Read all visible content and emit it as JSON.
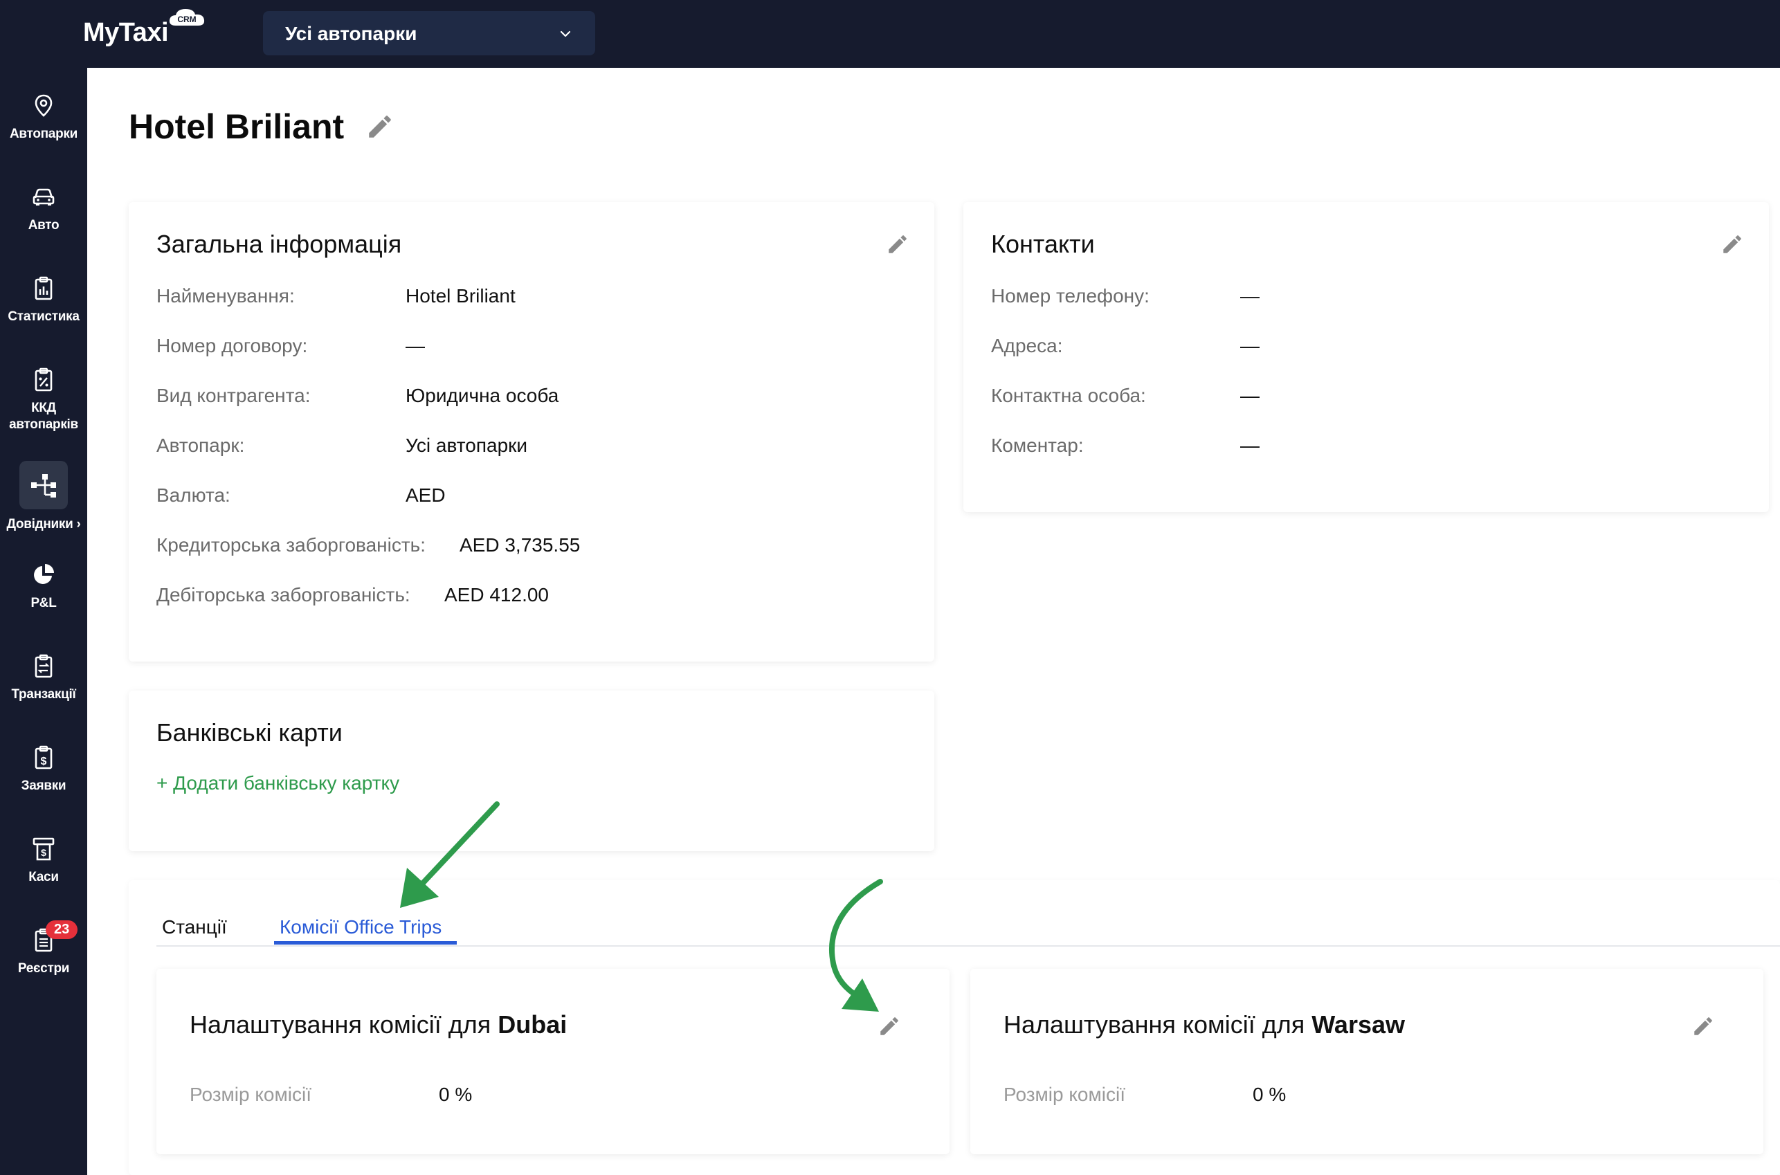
{
  "app": {
    "logo": "MyTaxi",
    "logo_badge": "CRM",
    "fleet_selector": {
      "value": "Усі автопарки"
    }
  },
  "sidebar": {
    "items": [
      {
        "label": "Автопарки",
        "icon": "location-pin-icon"
      },
      {
        "label": "Авто",
        "icon": "car-icon"
      },
      {
        "label": "Статистика",
        "icon": "stats-clipboard-icon"
      },
      {
        "label": "ККД автопарків",
        "icon": "percent-clipboard-icon"
      },
      {
        "label": "Довідники",
        "icon": "tree-structure-icon",
        "active": true
      },
      {
        "label": "P&L",
        "icon": "pie-chart-icon"
      },
      {
        "label": "Транзакції",
        "icon": "transactions-clipboard-icon"
      },
      {
        "label": "Заявки",
        "icon": "dollar-clipboard-icon"
      },
      {
        "label": "Каси",
        "icon": "cash-register-icon"
      },
      {
        "label": "Реєстри",
        "icon": "list-clipboard-icon",
        "badge": "23"
      }
    ]
  },
  "page": {
    "title": "Hotel Briliant"
  },
  "general_info": {
    "title": "Загальна інформація",
    "rows": [
      {
        "label": "Найменування:",
        "value": "Hotel Briliant"
      },
      {
        "label": "Номер договору:",
        "value": "—"
      },
      {
        "label": "Вид контрагента:",
        "value": "Юридична особа"
      },
      {
        "label": "Автопарк:",
        "value": "Усі автопарки"
      },
      {
        "label": "Валюта:",
        "value": "AED"
      },
      {
        "label": "Кредиторська заборгованість:",
        "value": "AED 3,735.55"
      },
      {
        "label": "Дебіторська заборгованість:",
        "value": "AED 412.00"
      }
    ]
  },
  "contacts": {
    "title": "Контакти",
    "rows": [
      {
        "label": "Номер телефону:",
        "value": "—"
      },
      {
        "label": "Адреса:",
        "value": "—"
      },
      {
        "label": "Контактна особа:",
        "value": "—"
      },
      {
        "label": "Коментар:",
        "value": "—"
      }
    ]
  },
  "bank_cards": {
    "title": "Банківські карти",
    "add_link": "+ Додати банківську картку"
  },
  "tabs": [
    {
      "label": "Станції",
      "active": false
    },
    {
      "label": "Комісії Office Trips",
      "active": true
    }
  ],
  "commissions": [
    {
      "title_prefix": "Налаштування комісії для",
      "city": "Dubai",
      "label": "Розмір комісії",
      "value": "0 %"
    },
    {
      "title_prefix": "Налаштування комісії для",
      "city": "Warsaw",
      "label": "Розмір комісії",
      "value": "0 %"
    }
  ],
  "colors": {
    "sidebar_bg": "#161b2e",
    "accent_blue": "#2a5bd7",
    "accent_green": "#2e9b4c",
    "badge_red": "#e5303b"
  }
}
